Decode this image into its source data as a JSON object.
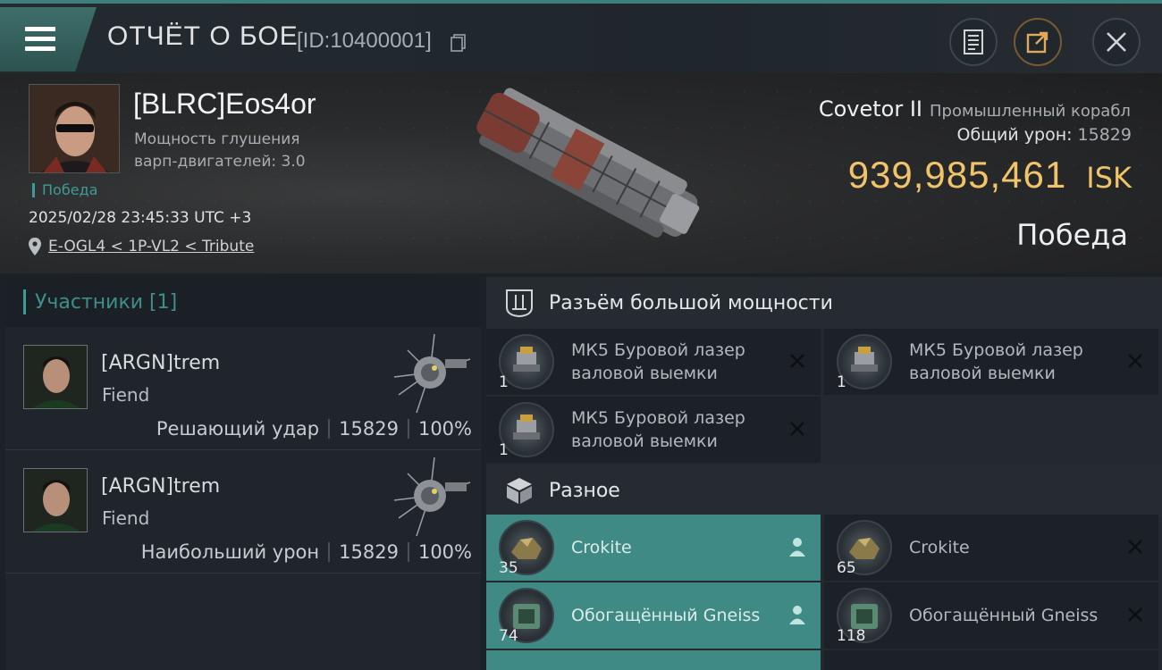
{
  "header": {
    "title": "ОТЧЁТ О БОЕ",
    "report_id": "[ID:10400001]"
  },
  "victim": {
    "name": "[BLRC]Eos4or",
    "warp_label": "Мощность глушения варп-двигателей: 3.0",
    "status": "Победа",
    "timestamp": "2025/02/28 23:45:33 UTC +3",
    "location": "E-OGL4 < 1P-VL2 < Tribute",
    "ship_name": "Covetor II",
    "ship_class": "Промышленный корабл",
    "total_damage_label": "Общий урон:",
    "total_damage": "15829",
    "isk_value": "939,985,461",
    "isk_unit": "ISK",
    "result": "Победа"
  },
  "participants": {
    "title": "Участники [1]",
    "rows": [
      {
        "name": "[ARGN]trem",
        "ship": "Fiend",
        "role": "Решающий удар",
        "damage": "15829",
        "percent": "100%"
      },
      {
        "name": "[ARGN]trem",
        "ship": "Fiend",
        "role": "Наибольший урон",
        "damage": "15829",
        "percent": "100%"
      }
    ]
  },
  "fitting": {
    "high_slots_title": "Разъём большой мощности",
    "misc_title": "Разное",
    "high_slots": [
      {
        "name": "МК5 Буровой лазер валовой выемки",
        "qty": "1"
      },
      {
        "name": "МК5 Буровой лазер валовой выемки",
        "qty": "1"
      },
      {
        "name": "МК5 Буровой лазер валовой выемки",
        "qty": "1"
      }
    ],
    "misc": [
      {
        "name": "Crokite",
        "qty": "35"
      },
      {
        "name": "Crokite",
        "qty": "65"
      },
      {
        "name": "Обогащённый Gneiss",
        "qty": "74"
      },
      {
        "name": "Обогащённый Gneiss",
        "qty": "118"
      }
    ]
  },
  "colors": {
    "accent_teal": "#3e9b95",
    "isk_gold": "#f1c46a",
    "highlight_row": "#3f8a84"
  },
  "icons": [
    "menu-icon",
    "copy-icon",
    "document-icon",
    "share-icon",
    "close-icon",
    "location-pin-icon",
    "high-slot-icon",
    "cargo-box-icon",
    "destroyed-x-icon",
    "dropped-person-icon"
  ]
}
